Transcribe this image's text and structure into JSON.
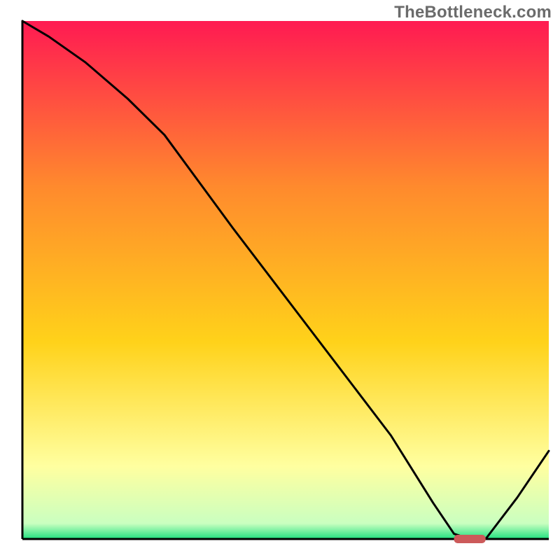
{
  "watermark": "TheBottleneck.com",
  "chart_data": {
    "type": "line",
    "title": "",
    "xlabel": "",
    "ylabel": "",
    "xlim": [
      0,
      100
    ],
    "ylim": [
      0,
      100
    ],
    "series": [
      {
        "name": "curve",
        "x": [
          0,
          5,
          12,
          20,
          27,
          40,
          55,
          70,
          78,
          82,
          85,
          88,
          94,
          100
        ],
        "values": [
          100,
          97,
          92,
          85,
          78,
          60,
          40,
          20,
          7,
          1,
          0,
          0,
          8,
          17
        ]
      }
    ],
    "flat_segment": {
      "x_start": 82,
      "x_end": 88,
      "y": 0
    }
  },
  "colors": {
    "gradient_top": "#ff1a52",
    "gradient_mid1": "#ff8a2d",
    "gradient_mid2": "#ffd21a",
    "gradient_pale": "#ffffa0",
    "gradient_green": "#1fe07f",
    "curve": "#000000",
    "marker": "#cc5a5a",
    "axis": "#000000"
  }
}
